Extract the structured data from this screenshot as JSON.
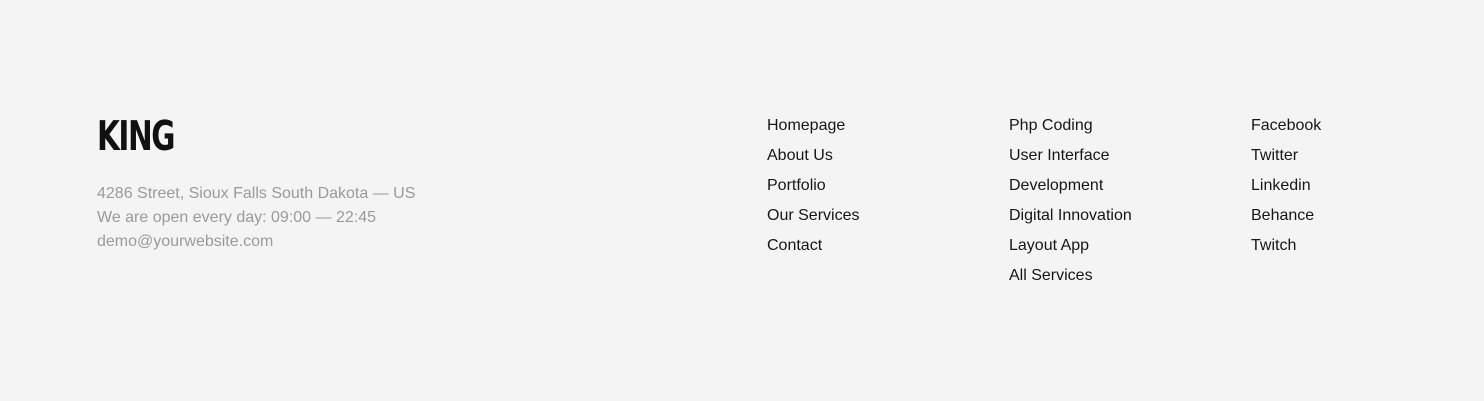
{
  "brand": {
    "logo_text": "KING",
    "address": "4286 Street, Sioux Falls South Dakota — US",
    "hours": "We are open every day: 09:00 — 22:45",
    "email": "demo@yourwebsite.com"
  },
  "columns": [
    {
      "links": [
        "Homepage",
        "About Us",
        "Portfolio",
        "Our Services",
        "Contact"
      ]
    },
    {
      "links": [
        "Php Coding",
        "User Interface",
        "Development",
        "Digital Innovation",
        "Layout App",
        "All Services"
      ]
    },
    {
      "links": [
        "Facebook",
        "Twitter",
        "Linkedin",
        "Behance",
        "Twitch"
      ]
    }
  ],
  "colors": {
    "background": "#f4f4f4",
    "logo": "#111111",
    "muted_text": "#9a9a9a",
    "link_text": "#161616"
  }
}
